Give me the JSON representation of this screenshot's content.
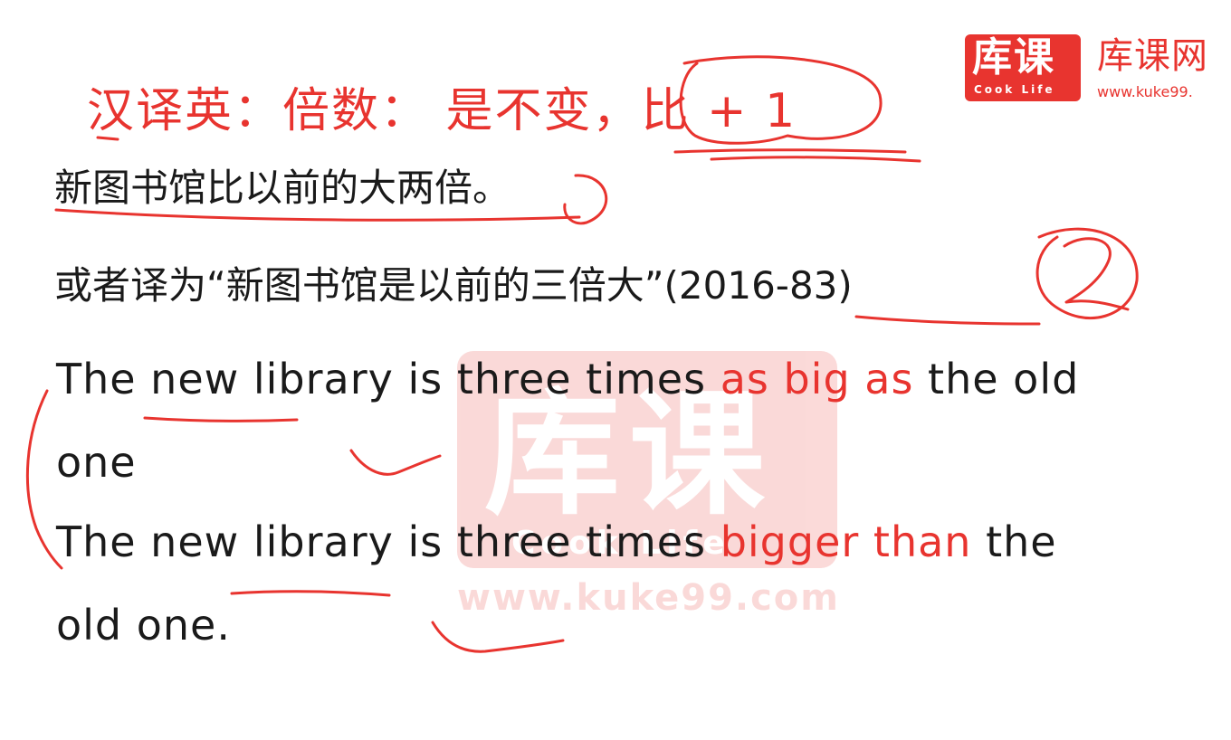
{
  "watermark": {
    "chars": "库课",
    "sub": "Cook Life",
    "url": "www.kuke99.com"
  },
  "logo": {
    "chars": "库课",
    "sub": "Cook Life",
    "name": "库课网",
    "url": "www.kuke99."
  },
  "title": "汉译英：倍数： 是不变，比 + 1",
  "cn_line_1": "新图书馆比以前的大两倍。",
  "cn_line_2": "或者译为“新图书馆是以前的三倍大”(2016-83)",
  "en_1": {
    "pre": "The new library is three times ",
    "highlight": "as big as",
    "post": " the old"
  },
  "en_2": "one",
  "en_3": {
    "pre": "The new library is three times ",
    "highlight": "bigger than",
    "post": "  the"
  },
  "en_4": "old one.",
  "colors": {
    "accent": "#e8342f",
    "text": "#1a1a1a",
    "background": "#ffffff"
  }
}
